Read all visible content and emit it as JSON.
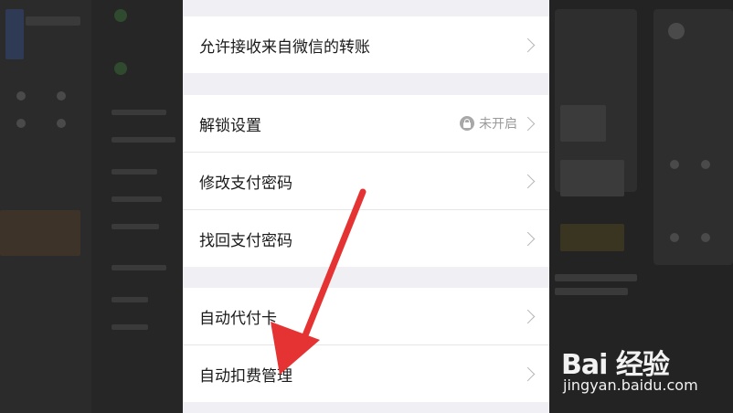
{
  "settings": {
    "group1": [
      {
        "label": "允许接收来自微信的转账"
      }
    ],
    "group2": [
      {
        "label": "解锁设置",
        "status": "未开启",
        "icon": "lock-icon"
      },
      {
        "label": "修改支付密码"
      },
      {
        "label": "找回支付密码"
      }
    ],
    "group3": [
      {
        "label": "自动代付卡"
      },
      {
        "label": "自动扣费管理"
      }
    ]
  },
  "overlay": {
    "arrow_color": "#e53333"
  },
  "watermark": {
    "logo_text": "Bai 经验",
    "url": "jingyan.baidu.com"
  },
  "colors": {
    "panel_bg": "#efeff4",
    "row_bg": "#ffffff",
    "chevron": "#b5b5b5"
  }
}
